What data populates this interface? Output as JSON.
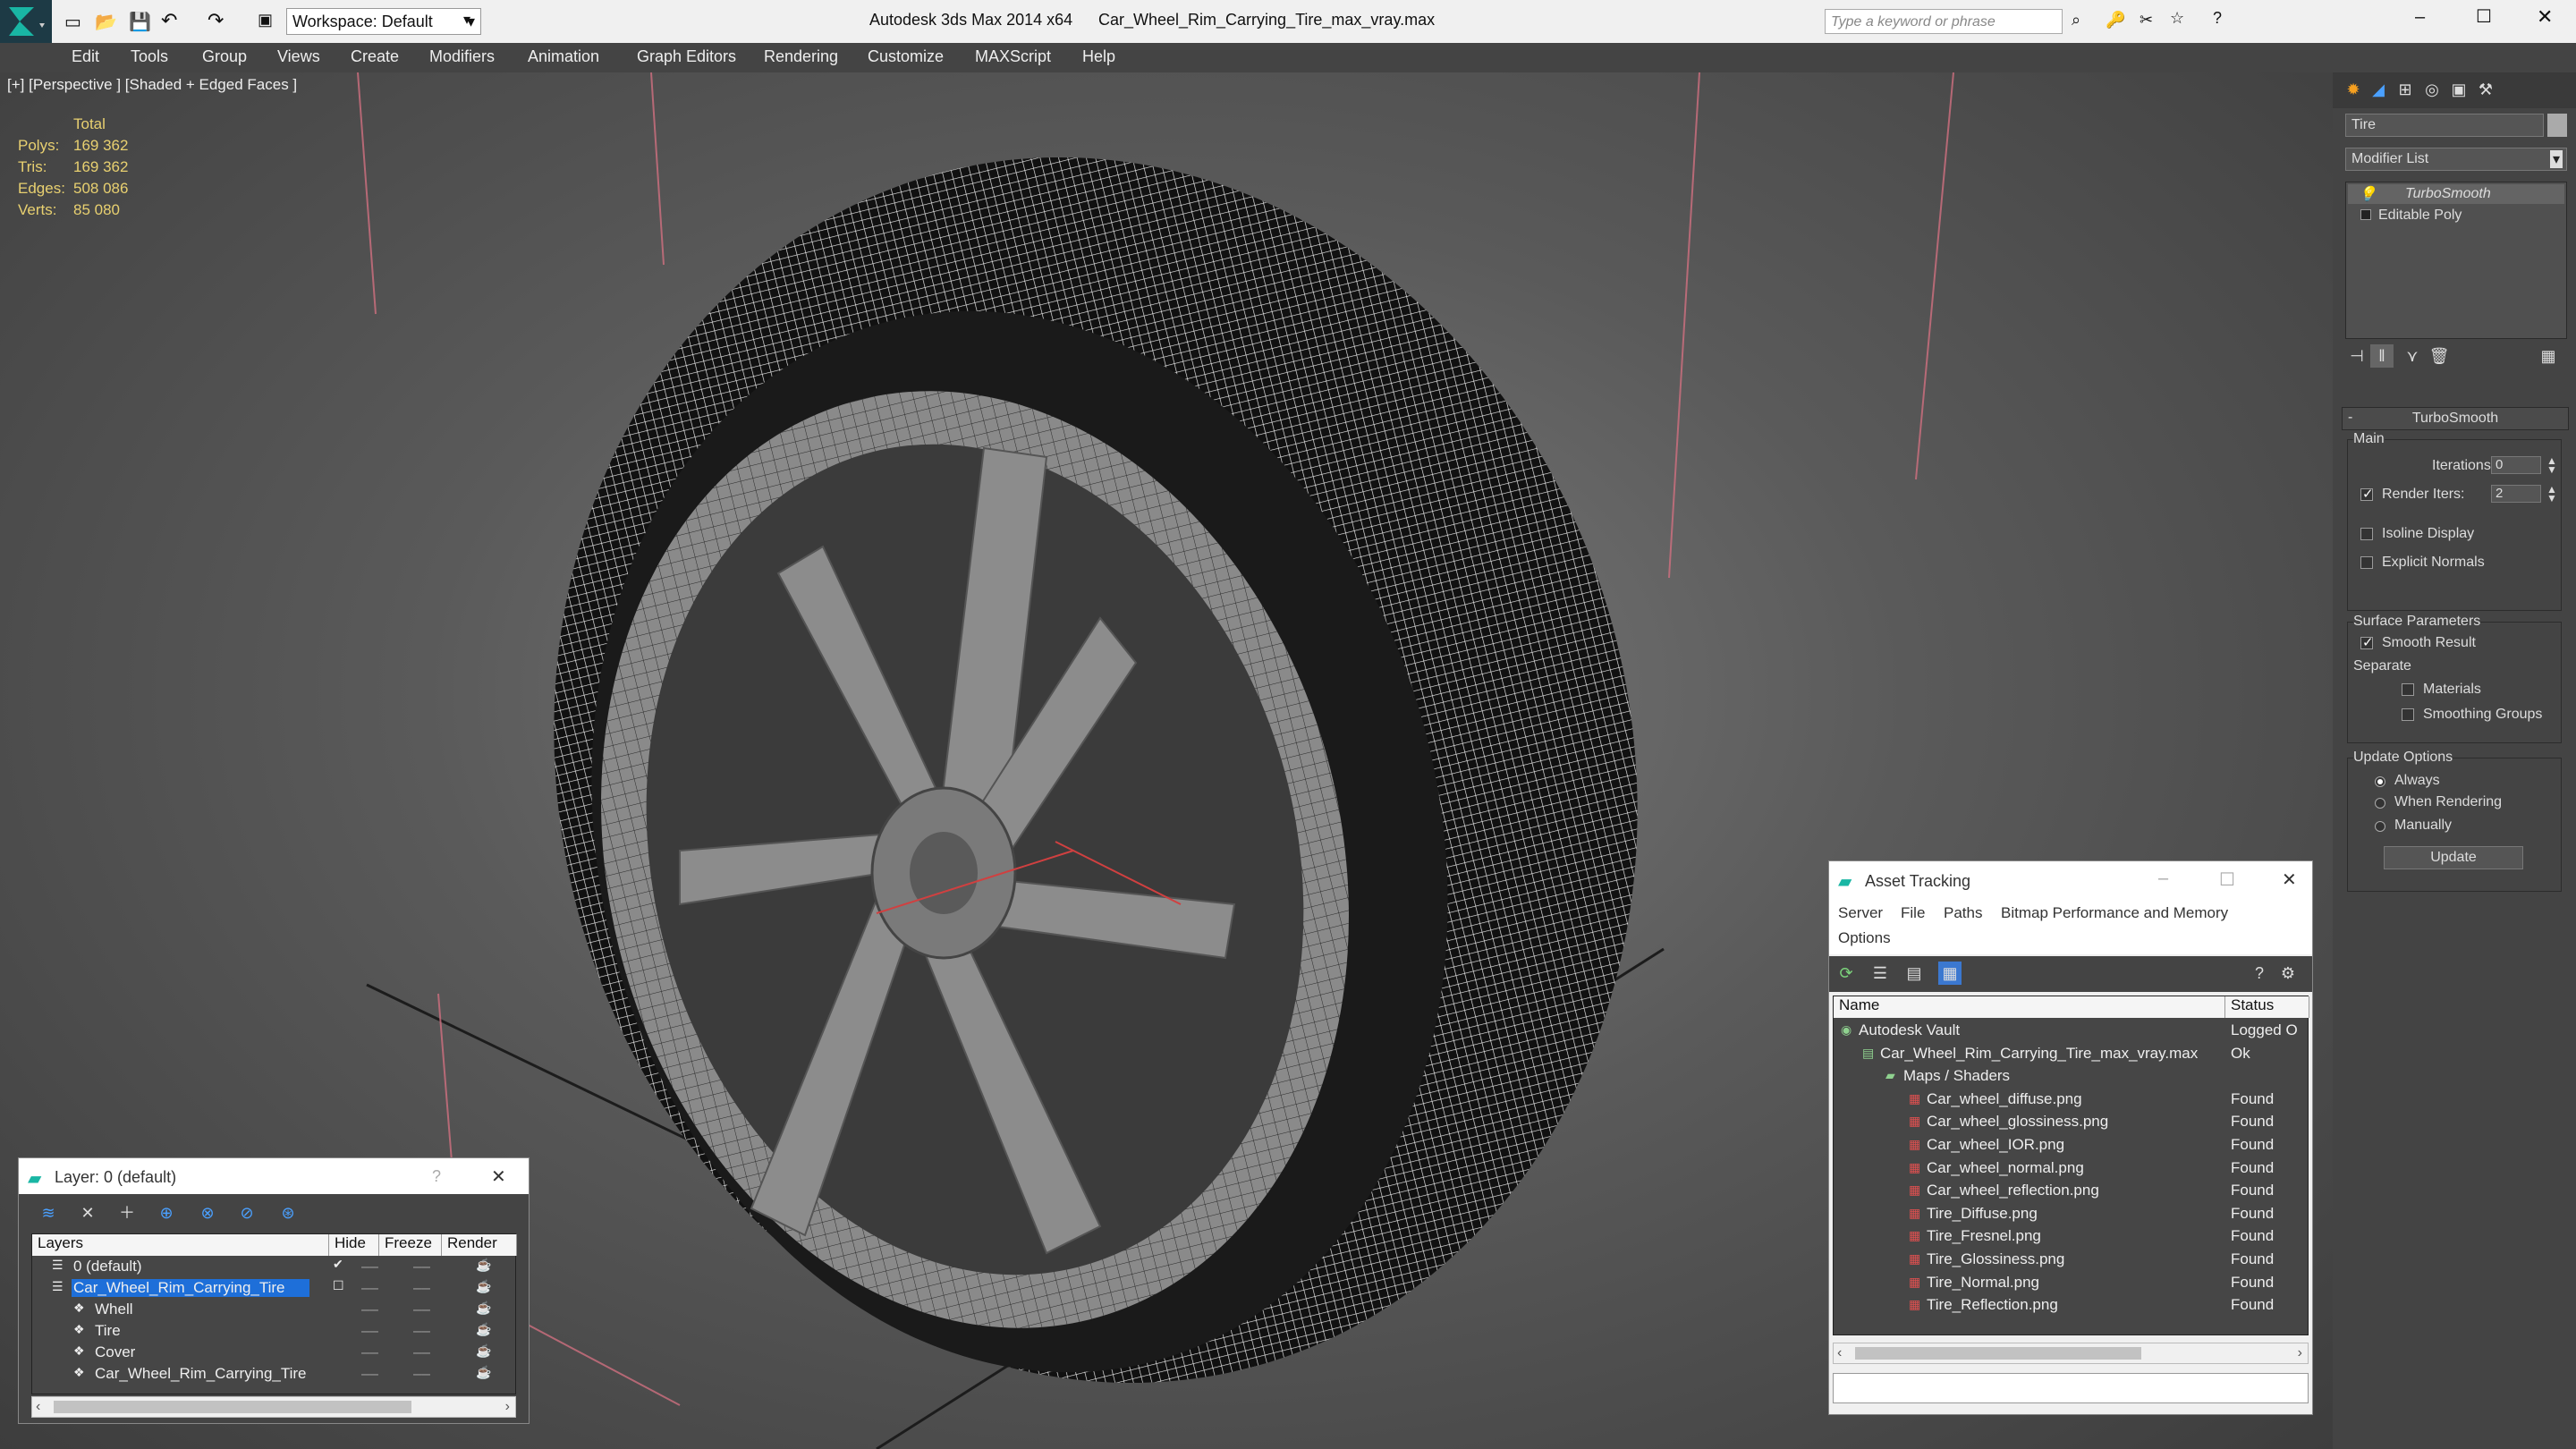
{
  "titlebar": {
    "workspace": "Workspace: Default",
    "app_title": "Autodesk 3ds Max  2014 x64",
    "file_title": "Car_Wheel_Rim_Carrying_Tire_max_vray.max",
    "search_placeholder": "Type a keyword or phrase"
  },
  "menu": [
    "Edit",
    "Tools",
    "Group",
    "Views",
    "Create",
    "Modifiers",
    "Animation",
    "Graph Editors",
    "Rendering",
    "Customize",
    "MAXScript",
    "Help"
  ],
  "viewport": {
    "label": "[+] [Perspective ] [Shaded + Edged Faces ]",
    "stats": {
      "header": "Total",
      "polys_label": "Polys:",
      "polys": "169 362",
      "tris_label": "Tris:",
      "tris": "169 362",
      "edges_label": "Edges:",
      "edges": "508 086",
      "verts_label": "Verts:",
      "verts": "85 080"
    }
  },
  "command_panel": {
    "object_name": "Tire",
    "modifier_list": "Modifier List",
    "stack": [
      "TurboSmooth",
      "Editable Poly"
    ],
    "rollout_title": "TurboSmooth",
    "main_label": "Main",
    "iterations_label": "Iterations:",
    "iterations": "0",
    "render_iters_label": "Render Iters:",
    "render_iters": "2",
    "isoline": "Isoline Display",
    "explicit_normals": "Explicit Normals",
    "surface_params": "Surface Parameters",
    "smooth_result": "Smooth Result",
    "separate": "Separate",
    "materials": "Materials",
    "smoothing_groups": "Smoothing Groups",
    "update_options": "Update Options",
    "always": "Always",
    "when_rendering": "When Rendering",
    "manually": "Manually",
    "update_button": "Update"
  },
  "asset_tracking": {
    "title": "Asset Tracking",
    "menu": [
      "Server",
      "File",
      "Paths",
      "Bitmap Performance and Memory"
    ],
    "menu2": "Options",
    "col_name": "Name",
    "col_status": "Status",
    "rows": [
      {
        "name": "Autodesk Vault",
        "status": "Logged O"
      },
      {
        "name": "Car_Wheel_Rim_Carrying_Tire_max_vray.max",
        "status": "Ok"
      },
      {
        "name": "Maps / Shaders",
        "status": ""
      },
      {
        "name": "Car_wheel_diffuse.png",
        "status": "Found"
      },
      {
        "name": "Car_wheel_glossiness.png",
        "status": "Found"
      },
      {
        "name": "Car_wheel_IOR.png",
        "status": "Found"
      },
      {
        "name": "Car_wheel_normal.png",
        "status": "Found"
      },
      {
        "name": "Car_wheel_reflection.png",
        "status": "Found"
      },
      {
        "name": "Tire_Diffuse.png",
        "status": "Found"
      },
      {
        "name": "Tire_Fresnel.png",
        "status": "Found"
      },
      {
        "name": "Tire_Glossiness.png",
        "status": "Found"
      },
      {
        "name": "Tire_Normal.png",
        "status": "Found"
      },
      {
        "name": "Tire_Reflection.png",
        "status": "Found"
      }
    ]
  },
  "layer_dialog": {
    "title": "Layer: 0 (default)",
    "help": "?",
    "col_layers": "Layers",
    "col_hide": "Hide",
    "col_freeze": "Freeze",
    "col_render": "Render",
    "rows": [
      {
        "name": "0 (default)"
      },
      {
        "name": "Car_Wheel_Rim_Carrying_Tire"
      },
      {
        "name": "Whell"
      },
      {
        "name": "Tire"
      },
      {
        "name": "Cover"
      },
      {
        "name": "Car_Wheel_Rim_Carrying_Tire"
      }
    ]
  },
  "colors": {
    "selection": "#1e6fd9",
    "stats_text": "#e8d070",
    "title_bg": "#f0f0f0"
  }
}
